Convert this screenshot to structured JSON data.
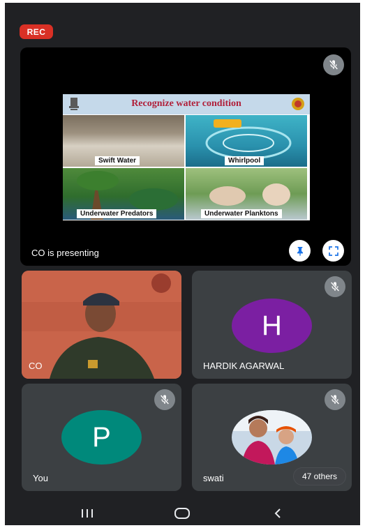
{
  "status": {
    "rec_label": "REC"
  },
  "presentation": {
    "presenter_label": "CO is presenting",
    "slide": {
      "title": "Recognize water condition",
      "captions": [
        "Swift Water",
        "Whirlpool",
        "Underwater Predators",
        "Underwater Planktons"
      ]
    }
  },
  "participants": [
    {
      "name": "CO",
      "type": "video"
    },
    {
      "name": "HARDIK AGARWAL",
      "initial": "H",
      "avatar_color": "#7b1fa2"
    },
    {
      "name": "You",
      "initial": "P",
      "avatar_color": "#00897b"
    },
    {
      "name": "swati",
      "type": "photo"
    }
  ],
  "others_label": "47 others",
  "colors": {
    "rec": "#d93025",
    "tile": "#3c4043",
    "background": "#202124",
    "mute_badge": "#80868b"
  },
  "icons": {
    "mute": "mic-off-icon",
    "pin": "pin-icon",
    "fullscreen": "fullscreen-icon",
    "nav_recents": "recents-icon",
    "nav_home": "home-icon",
    "nav_back": "back-icon"
  }
}
